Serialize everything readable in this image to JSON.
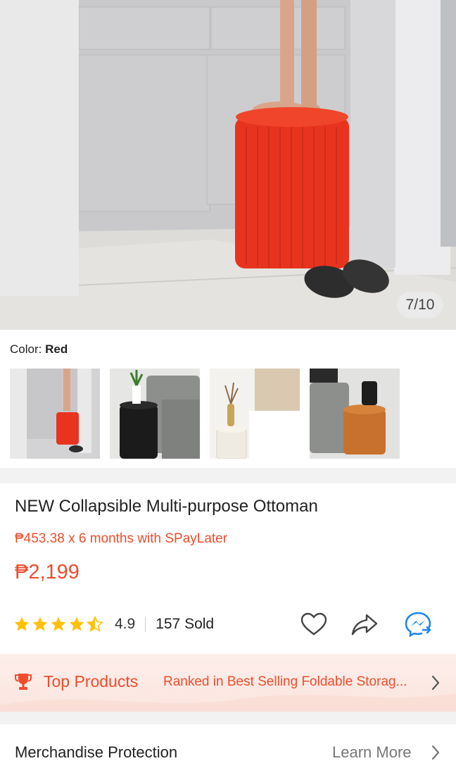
{
  "gallery": {
    "counter": "7/10",
    "color_label": "Color:",
    "color_value": "Red",
    "thumbnails": [
      {
        "name": "Red",
        "color": "#e8341f"
      },
      {
        "name": "Black",
        "color": "#1b1b1b"
      },
      {
        "name": "White",
        "color": "#f2efe8"
      },
      {
        "name": "Brown",
        "color": "#c8702e"
      }
    ]
  },
  "product": {
    "title": "NEW Collapsible Multi-purpose Ottoman",
    "installment": "₱453.38 x 6 months with SPayLater",
    "price": "₱2,199",
    "rating": "4.9",
    "rating_value": 4.5,
    "rating_max": 5,
    "sold": "157 Sold"
  },
  "actions": {
    "like_icon": "heart-icon",
    "share_icon": "share-icon",
    "chat_icon": "messenger-icon"
  },
  "top_products": {
    "label": "Top Products",
    "description": "Ranked in Best Selling Foldable Storag..."
  },
  "merchandise": {
    "title": "Merchandise Protection",
    "link": "Learn More"
  },
  "colors": {
    "accent": "#ee4d2d",
    "star": "#ffc107",
    "messenger": "#1d87f0"
  }
}
